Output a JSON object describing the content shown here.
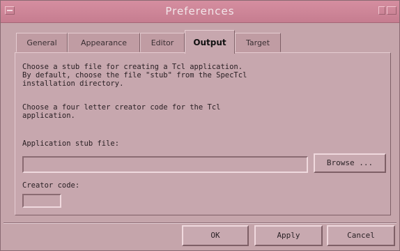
{
  "window": {
    "title": "Preferences"
  },
  "tabs": [
    {
      "label": "General",
      "active": false
    },
    {
      "label": "Appearance",
      "active": false
    },
    {
      "label": "Editor",
      "active": false
    },
    {
      "label": "Output",
      "active": true
    },
    {
      "label": "Target",
      "active": false
    }
  ],
  "panel": {
    "description_1": "Choose a stub file for creating a Tcl application.\nBy default, choose the file \"stub\" from the SpecTcl\ninstallation directory.",
    "description_2": "Choose a four letter creator code for the Tcl\napplication.",
    "stub_label": "Application stub file:",
    "stub_value": "",
    "browse_label": "Browse ...",
    "creator_label": "Creator code:",
    "creator_value": ""
  },
  "buttons": {
    "ok": "OK",
    "apply": "Apply",
    "cancel": "Cancel"
  }
}
